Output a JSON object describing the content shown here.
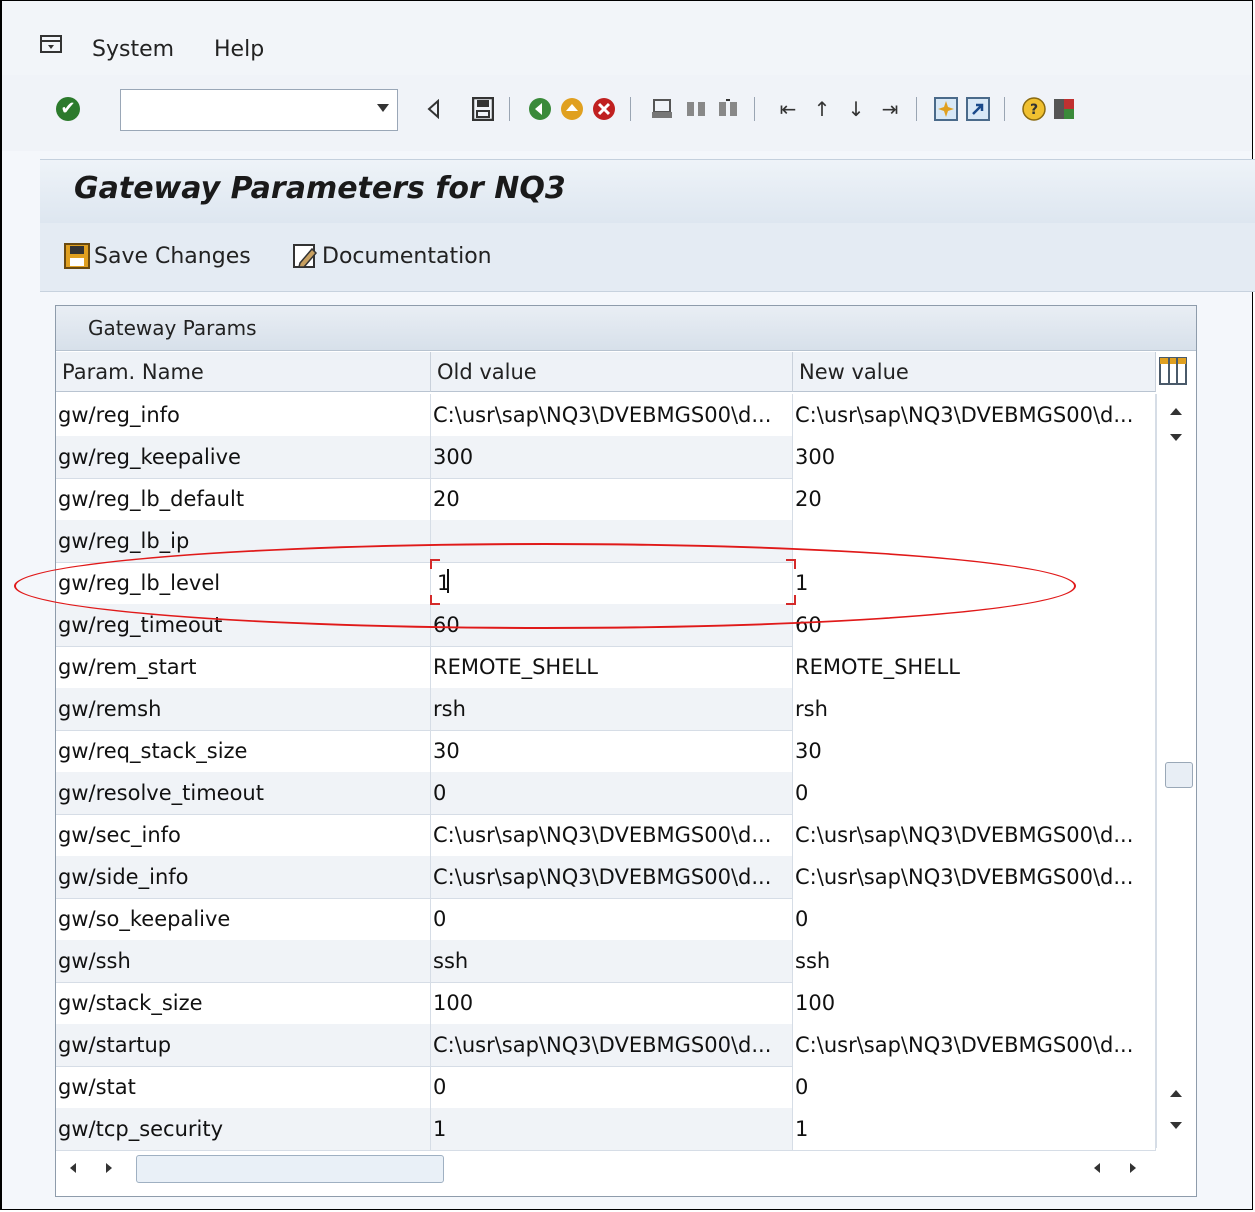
{
  "menu": {
    "items": [
      {
        "label": "System"
      },
      {
        "label": "Help"
      }
    ]
  },
  "toolbar": {
    "command_field_value": "",
    "icons": [
      "enter-icon",
      "back-triangle-icon",
      "save-icon",
      "back-icon",
      "exit-icon",
      "cancel-icon",
      "print-icon",
      "find-icon",
      "find-next-icon",
      "first-page-icon",
      "previous-page-icon",
      "next-page-icon",
      "last-page-icon",
      "create-session-icon",
      "shortcut-icon",
      "help-icon",
      "customize-layout-icon"
    ]
  },
  "header": {
    "title": "Gateway Parameters for NQ3"
  },
  "app_toolbar": {
    "save_label": "Save Changes",
    "doc_label": "Documentation"
  },
  "table": {
    "panel_title": "Gateway Params",
    "columns": [
      "Param. Name",
      "Old value",
      "New value"
    ],
    "rows": [
      {
        "name": "gw/reg_info",
        "old": "C:\\usr\\sap\\NQ3\\DVEBMGS00\\d...",
        "new": "C:\\usr\\sap\\NQ3\\DVEBMGS00\\d..."
      },
      {
        "name": "gw/reg_keepalive",
        "old": "300",
        "new": "300"
      },
      {
        "name": "gw/reg_lb_default",
        "old": "20",
        "new": "20"
      },
      {
        "name": "gw/reg_lb_ip",
        "old": "",
        "new": ""
      },
      {
        "name": "gw/reg_lb_level",
        "old": "1",
        "new": "1"
      },
      {
        "name": "gw/reg_timeout",
        "old": "60",
        "new": "60"
      },
      {
        "name": "gw/rem_start",
        "old": "REMOTE_SHELL",
        "new": "REMOTE_SHELL"
      },
      {
        "name": "gw/remsh",
        "old": "rsh",
        "new": "rsh"
      },
      {
        "name": "gw/req_stack_size",
        "old": "30",
        "new": "30"
      },
      {
        "name": "gw/resolve_timeout",
        "old": "0",
        "new": "0"
      },
      {
        "name": "gw/sec_info",
        "old": "C:\\usr\\sap\\NQ3\\DVEBMGS00\\d...",
        "new": "C:\\usr\\sap\\NQ3\\DVEBMGS00\\d..."
      },
      {
        "name": "gw/side_info",
        "old": "C:\\usr\\sap\\NQ3\\DVEBMGS00\\d...",
        "new": "C:\\usr\\sap\\NQ3\\DVEBMGS00\\d..."
      },
      {
        "name": "gw/so_keepalive",
        "old": "0",
        "new": "0"
      },
      {
        "name": "gw/ssh",
        "old": "ssh",
        "new": "ssh"
      },
      {
        "name": "gw/stack_size",
        "old": "100",
        "new": "100"
      },
      {
        "name": "gw/startup",
        "old": "C:\\usr\\sap\\NQ3\\DVEBMGS00\\d...",
        "new": "C:\\usr\\sap\\NQ3\\DVEBMGS00\\d..."
      },
      {
        "name": "gw/stat",
        "old": "0",
        "new": "0"
      },
      {
        "name": "gw/tcp_security",
        "old": "1",
        "new": "1"
      }
    ]
  },
  "colors": {
    "highlight_ellipse": "#e01919",
    "header_bg": "#dde6f0"
  }
}
